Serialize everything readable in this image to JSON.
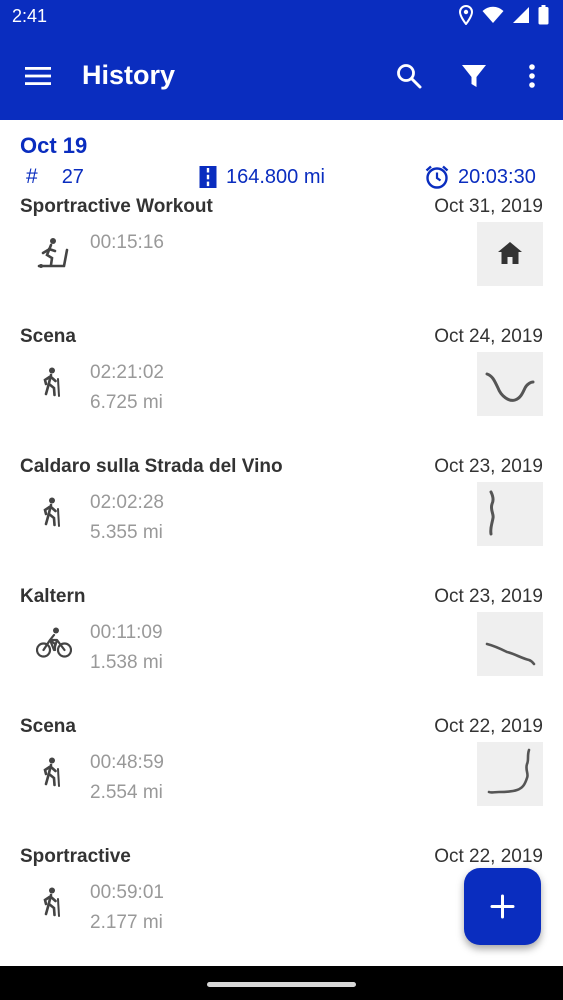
{
  "status": {
    "time": "2:41"
  },
  "appbar": {
    "title": "History"
  },
  "summary": {
    "date": "Oct 19",
    "count_prefix": "#",
    "count": "27",
    "distance": "164.800 mi",
    "duration": "20:03:30"
  },
  "items": [
    {
      "name": "Sportractive Workout",
      "date": "Oct 31, 2019",
      "time": "00:15:16",
      "distance": "",
      "activity_icon": "treadmill-icon",
      "thumb": "home-icon"
    },
    {
      "name": "Scena",
      "date": "Oct 24, 2019",
      "time": "02:21:02",
      "distance": "6.725 mi",
      "activity_icon": "hiking-icon",
      "thumb": "route-map"
    },
    {
      "name": "Caldaro sulla Strada del Vino",
      "date": "Oct 23, 2019",
      "time": "02:02:28",
      "distance": "5.355 mi",
      "activity_icon": "hiking-icon",
      "thumb": "route-map"
    },
    {
      "name": "Kaltern",
      "date": "Oct 23, 2019",
      "time": "00:11:09",
      "distance": "1.538 mi",
      "activity_icon": "cycling-icon",
      "thumb": "route-map"
    },
    {
      "name": "Scena",
      "date": "Oct 22, 2019",
      "time": "00:48:59",
      "distance": "2.554 mi",
      "activity_icon": "hiking-icon",
      "thumb": "route-map"
    },
    {
      "name": "Sportractive",
      "date": "Oct 22, 2019",
      "time": "00:59:01",
      "distance": "2.177 mi",
      "activity_icon": "hiking-icon",
      "thumb": "route-map"
    }
  ],
  "colors": {
    "primary": "#0a2dbf",
    "title_text": "#333333",
    "secondary_text": "#999999",
    "thumb_bg": "#efefef",
    "route": "#555555"
  }
}
